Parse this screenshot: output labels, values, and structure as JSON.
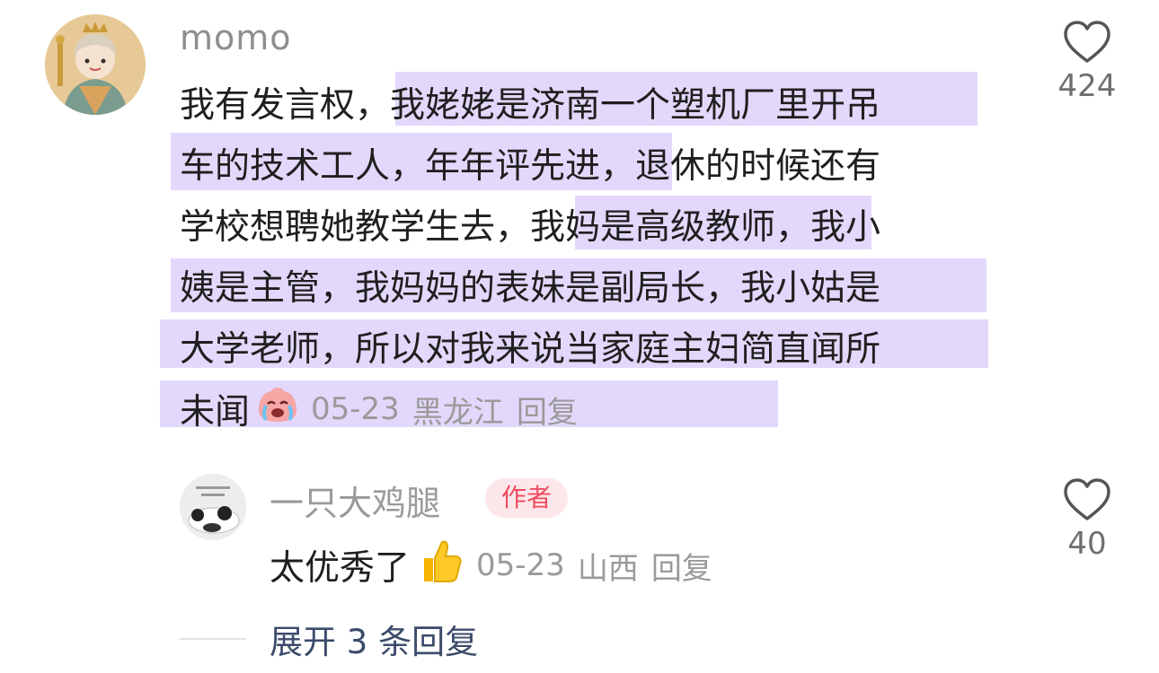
{
  "comment": {
    "username": "momo",
    "lines": [
      "我有发言权，我姥姥是济南一个塑机厂里开吊",
      "车的技术工人，年年评先进，退休的时候还有",
      "学校想聘她教学生去，我妈是高级教师，我小",
      "姨是主管，我妈妈的表妹是副局长，我小姑是",
      "大学老师，所以对我来说当家庭主妇简直闻所",
      "未闻"
    ],
    "date": "05-23",
    "location": "黑龙江",
    "reply_label": "回复",
    "like_count": "424"
  },
  "reply": {
    "username": "一只大鸡腿",
    "badge": "作者",
    "text": "太优秀了",
    "date": "05-23",
    "location": "山西",
    "reply_label": "回复",
    "like_count": "40"
  },
  "expand_label": "展开 3 条回复",
  "colors": {
    "highlight": "#e3d8fb",
    "badge_bg": "#fde7ea",
    "badge_text": "#ef4c5f"
  }
}
